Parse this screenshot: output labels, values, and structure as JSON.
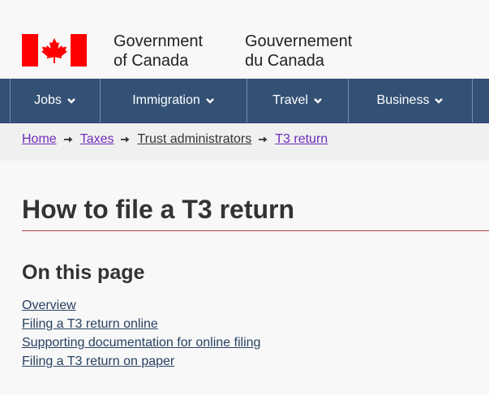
{
  "header": {
    "signature_en": [
      "Government",
      "of Canada"
    ],
    "signature_fr": [
      "Gouvernement",
      "du Canada"
    ]
  },
  "menu": {
    "items": [
      {
        "label": "Jobs",
        "icon": "chevron-down-icon"
      },
      {
        "label": "Immigration",
        "icon": "chevron-down-icon"
      },
      {
        "label": "Travel",
        "icon": "chevron-down-icon"
      },
      {
        "label": "Business",
        "icon": "chevron-down-icon"
      }
    ]
  },
  "breadcrumb": {
    "items": [
      {
        "label": "Home"
      },
      {
        "label": "Taxes"
      },
      {
        "label": "Trust administrators"
      },
      {
        "label": "T3 return"
      }
    ],
    "separator_icon": "arrow-right-icon"
  },
  "main": {
    "title": "How to file a T3 return",
    "toc_heading": "On this page",
    "toc_links": [
      "Overview",
      "Filing a T3 return online",
      "Supporting documentation for online filing",
      "Filing a T3 return on paper"
    ]
  },
  "colors": {
    "menu_bg": "#335075",
    "flag_red": "#ff0000",
    "visited_link": "#6d2dbb",
    "link": "#284162",
    "title_rule": "#af3c43"
  }
}
